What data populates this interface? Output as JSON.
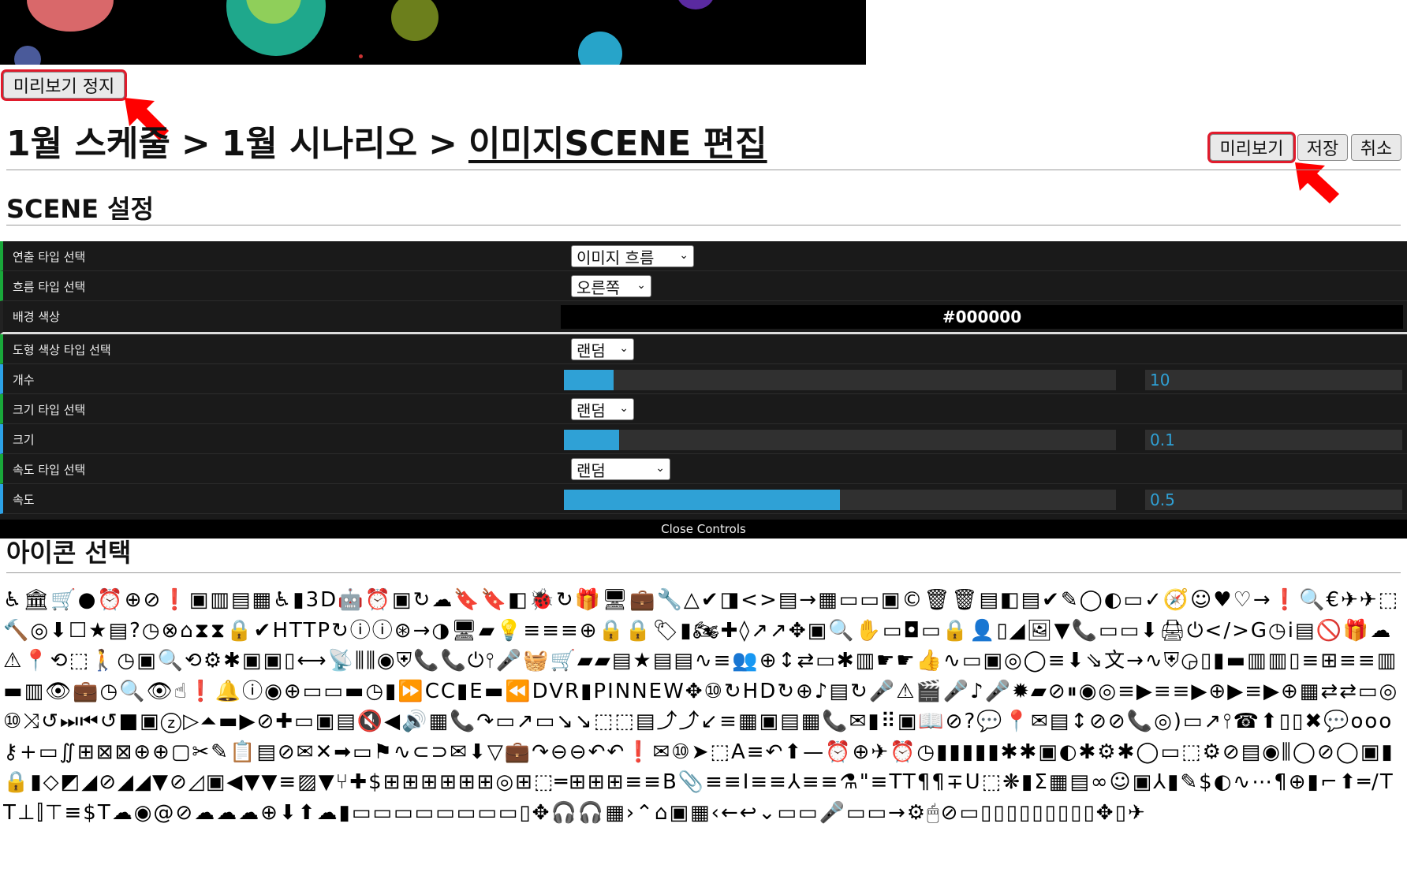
{
  "preview_stop_label": "미리보기 정지",
  "breadcrumb": {
    "level1": "1월 스케줄",
    "sep1": ">",
    "level2": "1월 시나리오",
    "sep2": ">",
    "current": "이미지SCENE 편집"
  },
  "actions": {
    "preview": "미리보기",
    "save": "저장",
    "cancel": "취소"
  },
  "scene_settings": {
    "title": "SCENE 설정",
    "rows": {
      "direction_type": {
        "label": "연출 타입 선택",
        "value": "이미지 흐름"
      },
      "flow_type": {
        "label": "흐름 타입 선택",
        "value": "오른쪽"
      },
      "bg_color": {
        "label": "배경 색상",
        "value": "#000000"
      },
      "shape_color_type": {
        "label": "도형 색상 타입 선택",
        "value": "랜덤"
      },
      "count": {
        "label": "개수",
        "value": "10",
        "fill_fraction": 0.09
      },
      "size_type": {
        "label": "크기 타입 선택",
        "value": "랜덤"
      },
      "size": {
        "label": "크기",
        "value": "0.1",
        "fill_fraction": 0.1
      },
      "speed_type": {
        "label": "속도 타입 선택",
        "value": "랜덤"
      },
      "speed": {
        "label": "속도",
        "value": "0.5",
        "fill_fraction": 0.5
      }
    },
    "close_controls": "Close Controls"
  },
  "icon_section": {
    "title": "아이콘 선택",
    "glyphs": "♿🏛🛒●⏰⊕⊘❗▣▥▤▦♿▮3D🤖⏰▣↻☁🔖🔖◧🐞↻🎁🖥💼🔧△✔◨<>▤→▦▭▭▣©🗑🗑▤◧▤✔✎◯◐▭✓🧭☺♥♡→❗🔍€✈✈⬚🔨◎⬇☐★▤?◷⊗⌂⧗⧗🔒✔HTTP↻ⓘⓘ⊛→◑🖥▰💡≡≡≡⊕🔒🔒🏷▮🏍✚◊↗↗✥▣🔍✋▭◘▭🔒👤▯◢🖼▼📞▭▭⬇🖨⏻</>G◷ⅰ▤🚫🎁☁⚠📍⟲⬚🚶◷▣🔍⟲⚙✱▣▣▯⟷📡⫼⫼◉⛨📞📞⏻⫯🎤🧺🛒▰▰▤★▤▤∿≡👥⊕↕⇄▭✱▥☛☛👍∿▭▣◎◯≡⬇⇘文→∿⛨◶▯▮▬▥▥▯≡⊞≡≡▥▬▥👁💼◷🔍👁☝❗🔔ⓘ◉⊕▭▭▬◷▮⏩CC▮E▬⏪DVR▮PINNEW✥⑩↻HD↻⊕♪▤↻🎤⚠🎬🎤♪🎤✹▰⊘⏸◉◎≡▶≡≡▶⊕▶≡▶⊕▦⇄⇄▭◎⑩⤨↺⏭⏮↺■▣ⓩ▷⏶▬▶⊘✚▭▣▤🔇◀🔊▦📞↷▭↗▭↘↘⬚⬚▤⤴⤴↙≡▦▣▤▦📞✉▮⠿▣📖⊘?💬📍✉▤↕⊘⊘📞◎)▭↗⫯☎⬆▯▯✖💬ooo⚷+▭∬⊞⊠⊠⊕⊕▢✂✎📋▤⊘✉✕➡▭⚑∿⊂⊃✉⬇▽💼↷⊖⊖↶↶❗✉⑩➤⬚A≡↶⬆—⏰⊕✈⏰◷▮▮▮▮▮✱✱▣◐✱⚙✱◯▭⬚⚙⊘▤◉⫼◯⊘◯▣▮🔒▮◇◩◢⊘◢◢▼⊘◿▣◀▼▼≡▨▼⑂✚$⊞⊞⊞⊞⊞⊞◎⊞⬚═⊞⊞⊞≡≡B📎≡≡I≡≡⅄≡≡⚗\"≡TT¶¶∓U⬚❋▮Σ▦▤∞☺▣⅄▮✎$◐∿⋯¶⊕▮⌐⬆═∕TT⊥⫿⊤≡$T☁◉@⊘☁☁☁⊕⬇⬆☁▮▭▭▭▭▭▭▭▭▯✥🎧🎧▦›⌃⌂▣▦‹←↩⌄▭▭🎤▭▭→⚙🖱⊘▭▯▯▯▯▯▯▯▯▯✥▯✈"
  }
}
